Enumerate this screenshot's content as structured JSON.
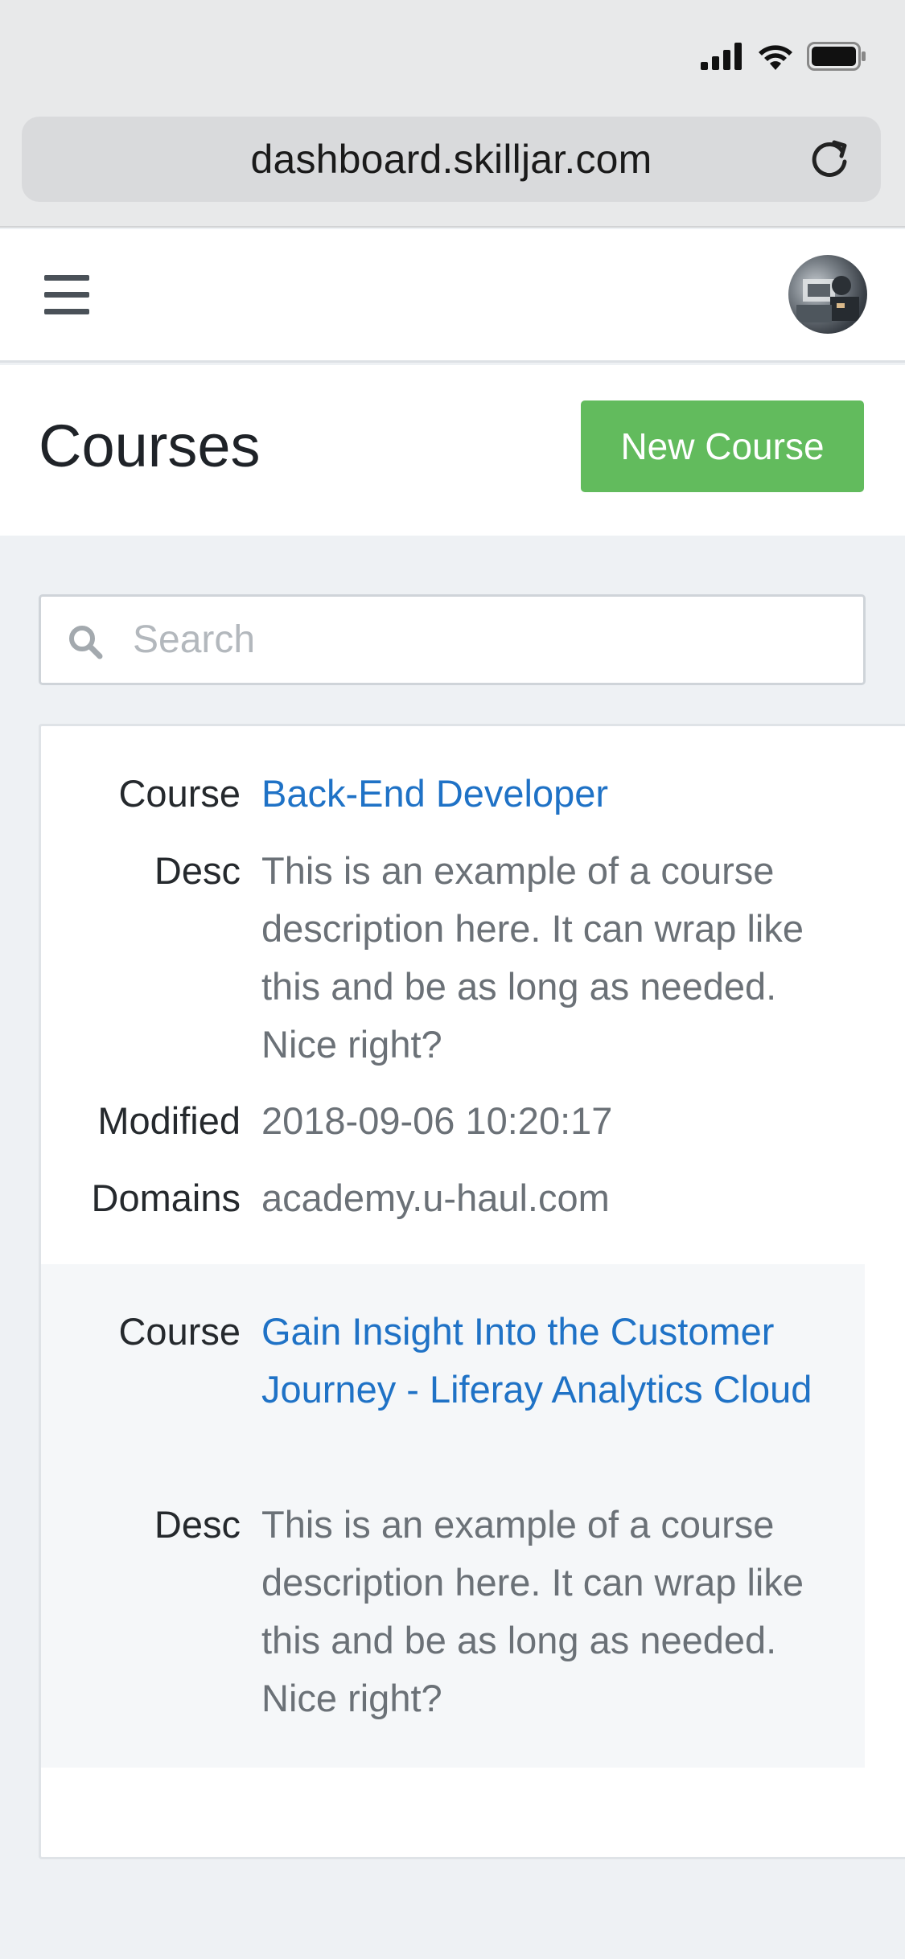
{
  "browser": {
    "url": "dashboard.skilljar.com"
  },
  "header": {
    "menu_icon": "hamburger-menu-icon",
    "avatar": "user-avatar"
  },
  "page": {
    "title": "Courses",
    "new_course_label": "New Course"
  },
  "search": {
    "placeholder": "Search",
    "value": ""
  },
  "courses": [
    {
      "course_label": "Course",
      "course_name": "Back-End Developer",
      "desc_label": "Desc",
      "desc": "This is an example of a course description here. It can wrap like this and be as long as needed. Nice right?",
      "modified_label": "Modified",
      "modified": "2018-09-06 10:20:17",
      "domains_label": "Domains",
      "domains": "academy.u-haul.com"
    },
    {
      "course_label": "Course",
      "course_name": "Gain Insight Into the Customer Journey - Liferay Analytics Cloud",
      "desc_label": "Desc",
      "desc": "This is an example of a course description here. It can wrap like this and be as long as needed. Nice right?"
    }
  ],
  "colors": {
    "accent_green": "#62bb5d",
    "link_blue": "#1f72c6"
  }
}
